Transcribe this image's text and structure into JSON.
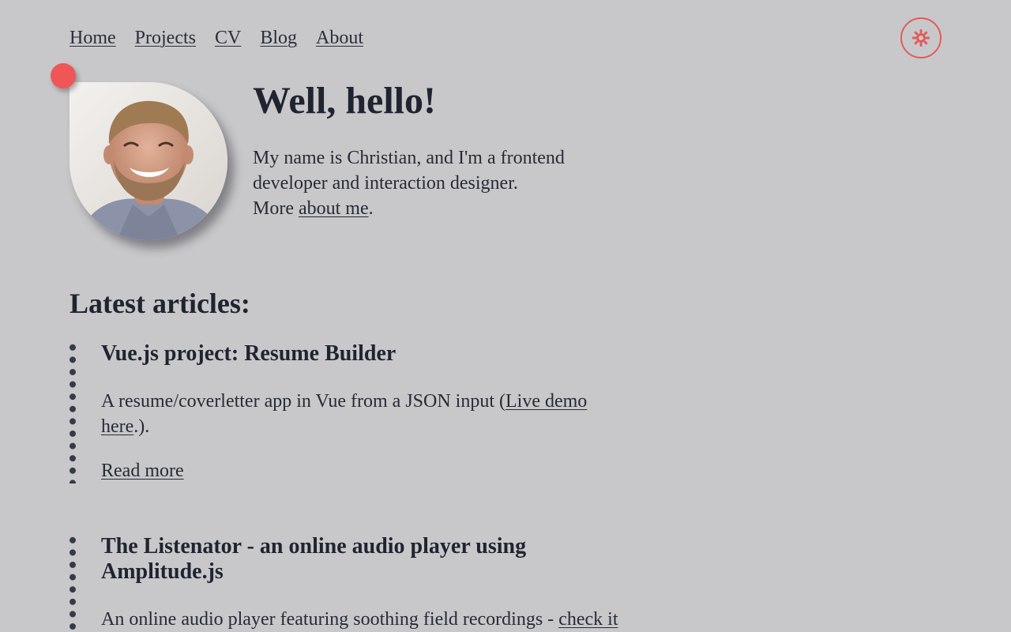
{
  "nav": {
    "items": [
      {
        "label": "Home"
      },
      {
        "label": "Projects"
      },
      {
        "label": "CV"
      },
      {
        "label": "Blog"
      },
      {
        "label": "About"
      }
    ]
  },
  "theme_toggle": {
    "icon": "sun-icon",
    "color": "#e35a5a"
  },
  "hero": {
    "title": "Well, hello!",
    "intro": "My name is Christian, and I'm a frontend developer and interaction designer.",
    "more_prefix": "More ",
    "about_link": "about me",
    "more_suffix": "."
  },
  "latest": {
    "title": "Latest articles:",
    "articles": [
      {
        "title": "Vue.js project: Resume Builder",
        "summary_prefix": "A resume/coverletter app in Vue from a JSON input (",
        "summary_link": "Live demo here",
        "summary_suffix": ".).",
        "read_more": "Read more"
      },
      {
        "title": "The Listenator - an online audio player using Amplitude.js",
        "summary_prefix": "An online audio player featuring soothing field recordings - ",
        "summary_link": "check it"
      }
    ]
  },
  "colors": {
    "background": "#c8c8ca",
    "text": "#1f2430",
    "accent": "#ef5658"
  }
}
